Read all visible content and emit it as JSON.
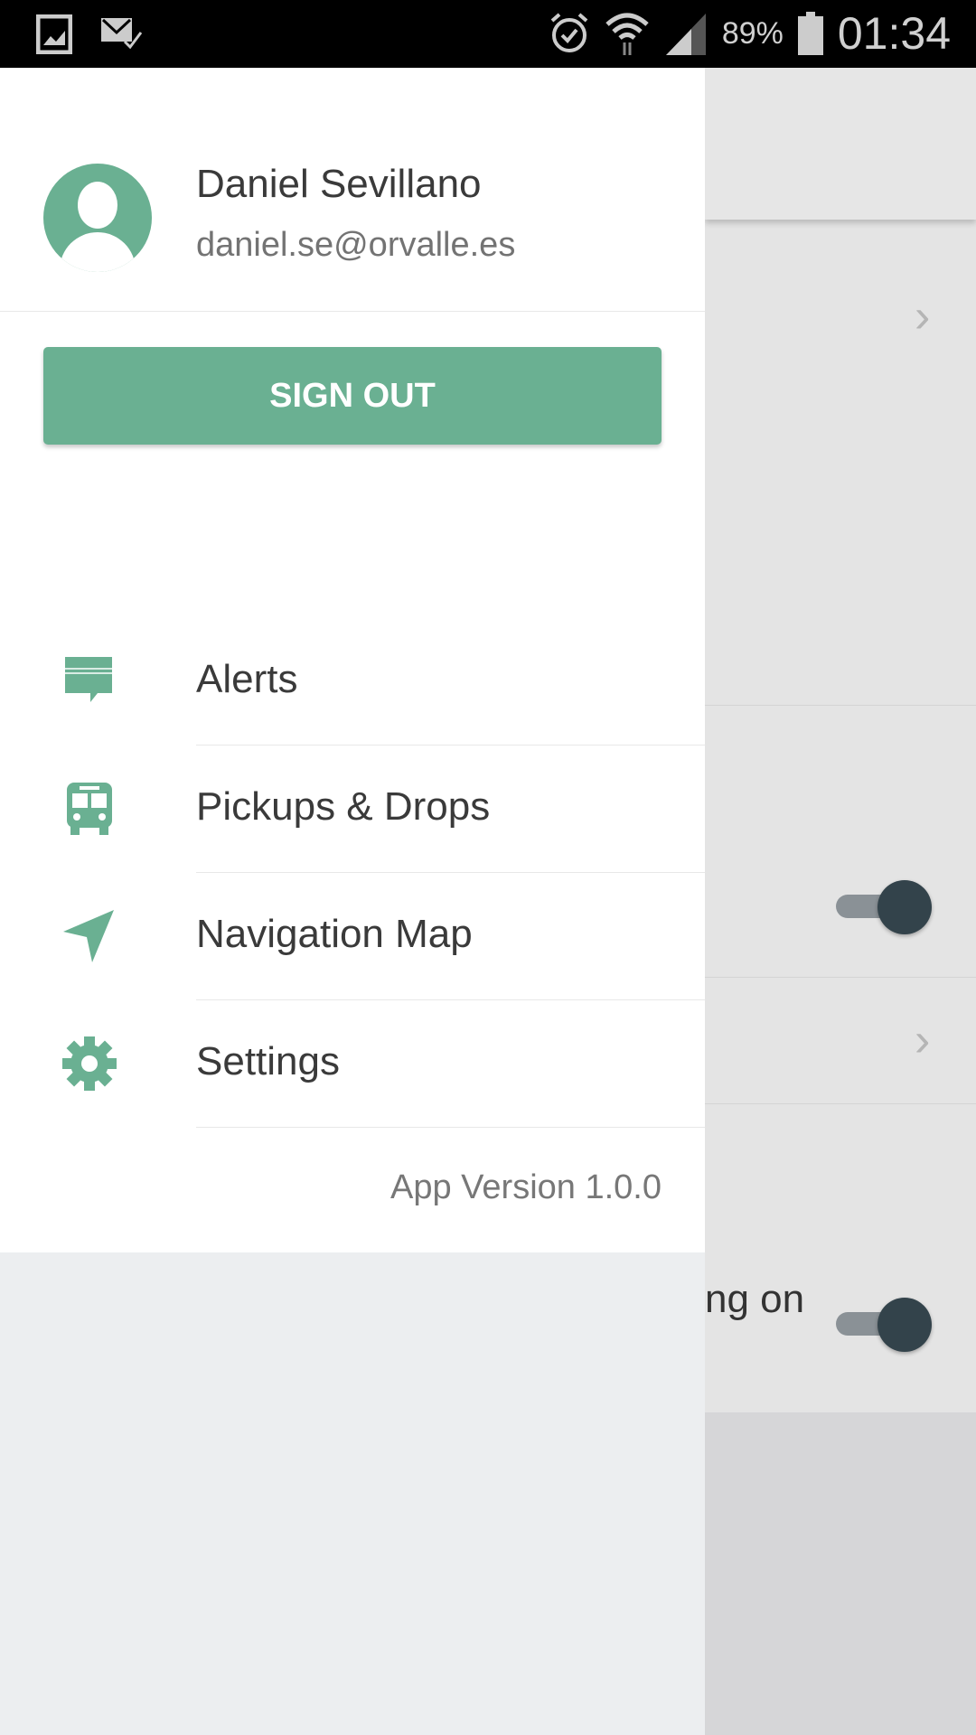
{
  "status_bar": {
    "battery": "89%",
    "time": "01:34",
    "icons": [
      "gallery-icon",
      "mail-check-icon",
      "alarm-icon",
      "wifi-icon",
      "signal-icon",
      "battery-icon"
    ]
  },
  "drawer": {
    "user": {
      "name": "Daniel Sevillano",
      "email": "daniel.se@orvalle.es"
    },
    "sign_out_label": "SIGN OUT",
    "menu": [
      {
        "label": "Alerts",
        "icon": "chat-bubble-icon"
      },
      {
        "label": "Pickups & Drops",
        "icon": "bus-icon"
      },
      {
        "label": "Navigation Map",
        "icon": "navigation-arrow-icon"
      },
      {
        "label": "Settings",
        "icon": "gear-icon"
      }
    ],
    "app_version": "App Version 1.0.0"
  },
  "background": {
    "partial_text": "ng on",
    "toggles": [
      true,
      true
    ]
  },
  "colors": {
    "accent": "#6ab092",
    "toggle_thumb": "#33434b"
  }
}
